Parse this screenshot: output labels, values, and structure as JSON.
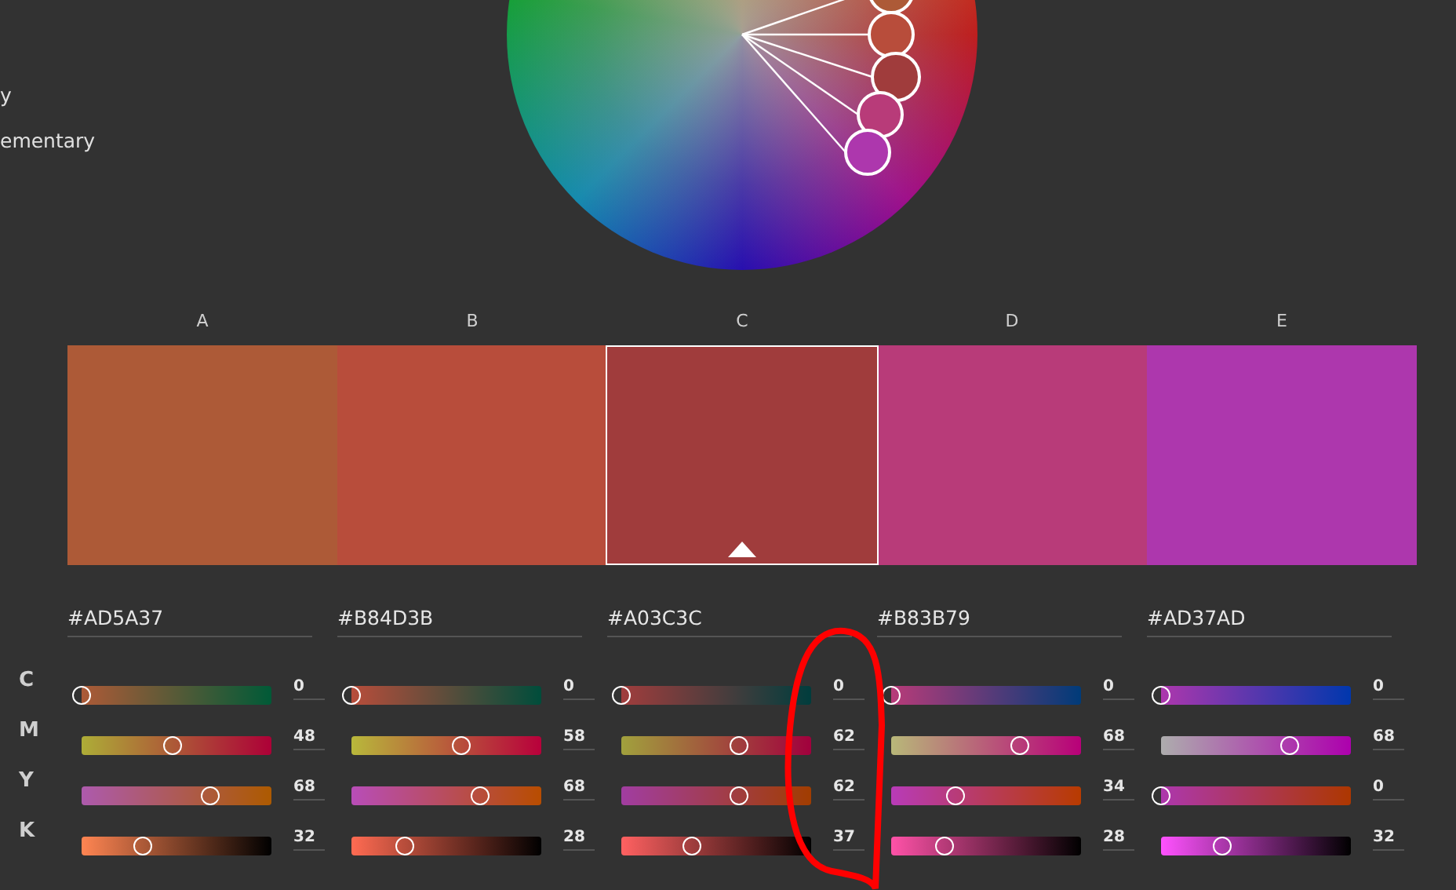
{
  "harmony_rules": [
    {
      "label": "y"
    },
    {
      "label": "ementary"
    }
  ],
  "channel_labels": [
    "C",
    "M",
    "Y",
    "K"
  ],
  "swatches": [
    {
      "label": "A",
      "hex": "#AD5A37",
      "color": "#ad5a37",
      "selected": false,
      "channels": [
        {
          "value": "0",
          "level": 0
        },
        {
          "value": "48",
          "level": 0.48
        },
        {
          "value": "68",
          "level": 0.68
        },
        {
          "value": "32",
          "level": 0.32
        }
      ]
    },
    {
      "label": "B",
      "hex": "#B84D3B",
      "color": "#b84d3b",
      "selected": false,
      "channels": [
        {
          "value": "0",
          "level": 0
        },
        {
          "value": "58",
          "level": 0.58
        },
        {
          "value": "68",
          "level": 0.68
        },
        {
          "value": "28",
          "level": 0.28
        }
      ]
    },
    {
      "label": "C",
      "hex": "#A03C3C",
      "color": "#a03c3c",
      "selected": true,
      "channels": [
        {
          "value": "0",
          "level": 0
        },
        {
          "value": "62",
          "level": 0.62
        },
        {
          "value": "62",
          "level": 0.62
        },
        {
          "value": "37",
          "level": 0.37
        }
      ]
    },
    {
      "label": "D",
      "hex": "#B83B79",
      "color": "#b83b79",
      "selected": false,
      "channels": [
        {
          "value": "0",
          "level": 0
        },
        {
          "value": "68",
          "level": 0.68
        },
        {
          "value": "34",
          "level": 0.34
        },
        {
          "value": "28",
          "level": 0.28
        }
      ]
    },
    {
      "label": "E",
      "hex": "#AD37AD",
      "color": "#ad37ad",
      "selected": false,
      "channels": [
        {
          "value": "0",
          "level": 0
        },
        {
          "value": "68",
          "level": 0.68
        },
        {
          "value": "0",
          "level": 0
        },
        {
          "value": "32",
          "level": 0.32
        }
      ]
    }
  ]
}
